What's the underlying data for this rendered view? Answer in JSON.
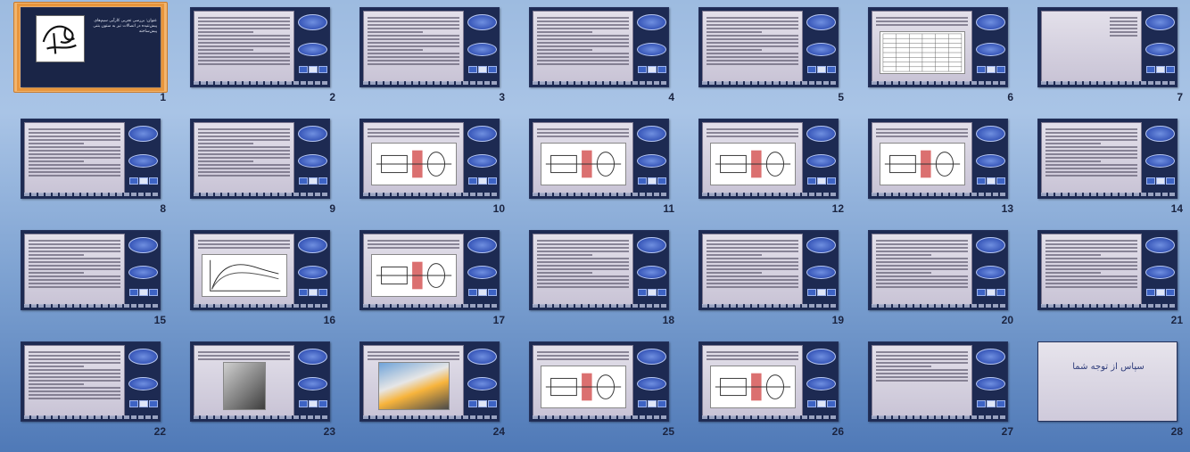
{
  "app": {
    "view": "Slide Sorter"
  },
  "colors": {
    "accent_selected": "#e8953c",
    "slide_dark": "#1d2a52",
    "button_blue": "#3756b8"
  },
  "slides": [
    {
      "number": "1",
      "title": "",
      "kind": "title",
      "text": "عنوان: بررسی تجربی کارآیی سیم‌های پیش‌تنیده در اتصالات تیر به ستون بتنی پیش‌ساخته",
      "selected": true
    },
    {
      "number": "2",
      "title": "مقدمه",
      "kind": "text"
    },
    {
      "number": "3",
      "title": "مقدمه",
      "kind": "text"
    },
    {
      "number": "4",
      "title": "مقدمه",
      "kind": "text"
    },
    {
      "number": "5",
      "title": "",
      "kind": "text"
    },
    {
      "number": "6",
      "title": "",
      "kind": "table"
    },
    {
      "number": "7",
      "title": "",
      "kind": "bullets"
    },
    {
      "number": "8",
      "title": "",
      "kind": "text"
    },
    {
      "number": "9",
      "title": "",
      "kind": "text"
    },
    {
      "number": "10",
      "title": "",
      "kind": "diagram"
    },
    {
      "number": "11",
      "title": "",
      "kind": "figure"
    },
    {
      "number": "12",
      "title": "",
      "kind": "figure"
    },
    {
      "number": "13",
      "title": "",
      "kind": "figure"
    },
    {
      "number": "14",
      "title": "",
      "kind": "text"
    },
    {
      "number": "15",
      "title": "",
      "kind": "text"
    },
    {
      "number": "16",
      "title": "",
      "kind": "graph"
    },
    {
      "number": "17",
      "title": "",
      "kind": "figure"
    },
    {
      "number": "18",
      "title": "",
      "kind": "text"
    },
    {
      "number": "19",
      "title": "",
      "kind": "text"
    },
    {
      "number": "20",
      "title": "",
      "kind": "text"
    },
    {
      "number": "21",
      "title": "",
      "kind": "text"
    },
    {
      "number": "22",
      "title": "",
      "kind": "text"
    },
    {
      "number": "23",
      "title": "",
      "kind": "photo"
    },
    {
      "number": "24",
      "title": "",
      "kind": "photo2"
    },
    {
      "number": "25",
      "title": "",
      "kind": "figure"
    },
    {
      "number": "26",
      "title": "",
      "kind": "figure"
    },
    {
      "number": "27",
      "title": "",
      "kind": "formula"
    },
    {
      "number": "28",
      "title": "",
      "kind": "thanks",
      "text": "سپاس از توجه شما"
    }
  ]
}
